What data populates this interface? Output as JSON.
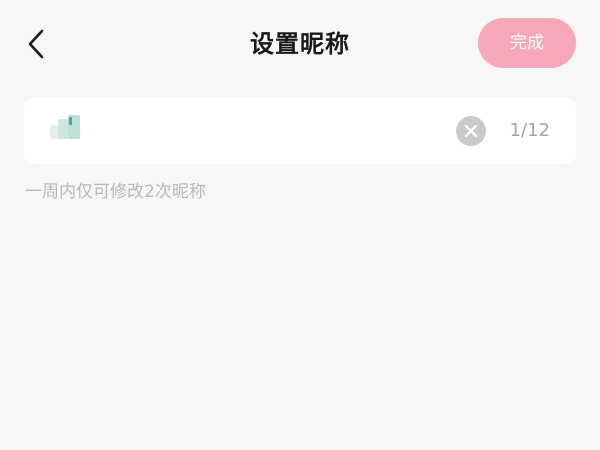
{
  "header": {
    "title": "设置昵称",
    "back_icon": "chevron-left-icon",
    "done_label": "完成"
  },
  "nickname": {
    "value": "",
    "char_count": "1/12",
    "clear_icon": "clear-circle-icon"
  },
  "hint": "一周内仅可修改2次昵称",
  "colors": {
    "background": "#f7f7f7",
    "done_button": "#f7a8b8",
    "hint_text": "#b8b8b8",
    "counter_text": "#a6a6a6"
  }
}
